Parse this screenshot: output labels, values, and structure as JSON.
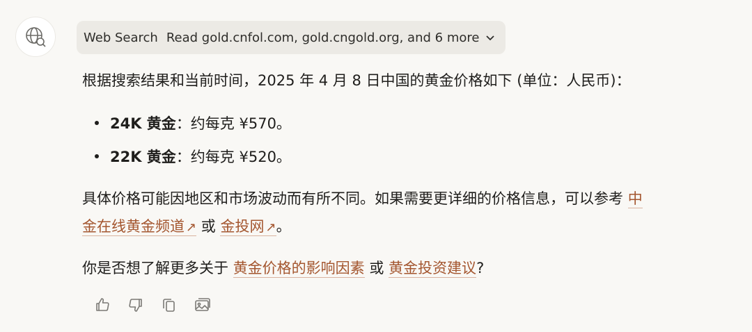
{
  "search": {
    "label": "Web Search",
    "detail": "Read gold.cnfol.com, gold.cngold.org, and 6 more"
  },
  "answer": {
    "intro": "根据搜索结果和当前时间，2025 年 4 月 8 日中国的黄金价格如下 (单位：人民币)：",
    "bullets": [
      {
        "bold": "24K 黄金",
        "rest": "：约每克 ¥570。"
      },
      {
        "bold": "22K 黄金",
        "rest": "：约每克 ¥520。"
      }
    ],
    "para2_prefix": "具体价格可能因地区和市场波动而有所不同。如果需要更详细的价格信息，可以参考",
    "link1_part1": "中",
    "link1_part2": "金在线黄金频道",
    "link_arrow": "↗",
    "or_text": "或",
    "link2": "金投网",
    "period": "。",
    "question_prefix": "你是否想了解更多关于",
    "q_link1": "黄金价格的影响因素",
    "q_or": "或",
    "q_link2": "黄金投资建议",
    "question_suffix": "?"
  },
  "colors": {
    "link": "#a4562f",
    "background": "#f9f8f5",
    "pill": "#eceae5"
  },
  "icons": [
    "globe-search-icon",
    "chevron-down-icon",
    "thumbs-up-icon",
    "thumbs-down-icon",
    "copy-icon",
    "image-icon"
  ]
}
